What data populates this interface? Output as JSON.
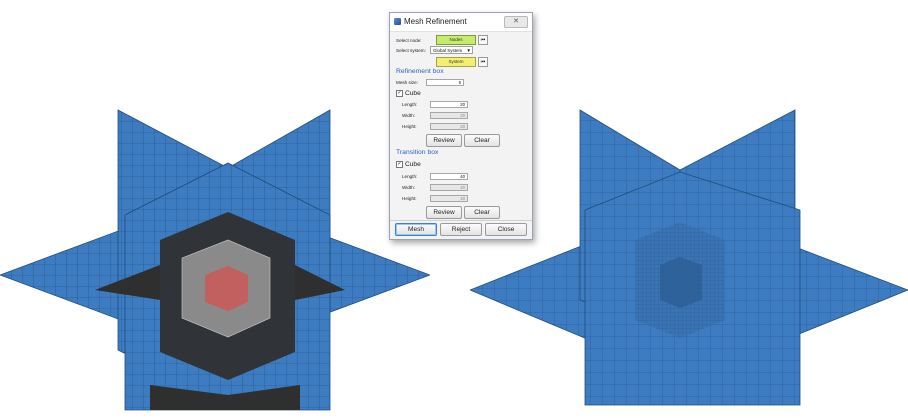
{
  "dialog": {
    "title": "Mesh Refinement",
    "close_symbol": "✕",
    "select_node_label": "Select node:",
    "nodes_button": "Nodes",
    "select_system_label": "Select system:",
    "system_value": "Global System",
    "system_button": "System",
    "reset_symbol": "⏮",
    "refinement": {
      "heading": "Refinement box",
      "mesh_size_label": "Mesh size:",
      "mesh_size_value": "5",
      "cube_label": "Cube",
      "length_label": "Length:",
      "length_value": "20",
      "width_label": "Width:",
      "width_value": "20",
      "height_label": "Height:",
      "height_value": "20",
      "review_button": "Review",
      "clear_button": "Clear"
    },
    "transition": {
      "heading": "Transition box",
      "cube_label": "Cube",
      "length_label": "Length:",
      "length_value": "40",
      "width_label": "Width:",
      "width_value": "40",
      "height_label": "Height:",
      "height_value": "40",
      "review_button": "Review",
      "clear_button": "Clear"
    },
    "mesh_button": "Mesh",
    "reject_button": "Reject",
    "close_button": "Close"
  },
  "colors": {
    "mesh_blue": "#3d7cc0",
    "mesh_line": "#1f4d7e",
    "transition_dark": "#2f2f2f",
    "refinement_gray": "#8a8a8a",
    "refinement_red": "#c85a5a"
  }
}
